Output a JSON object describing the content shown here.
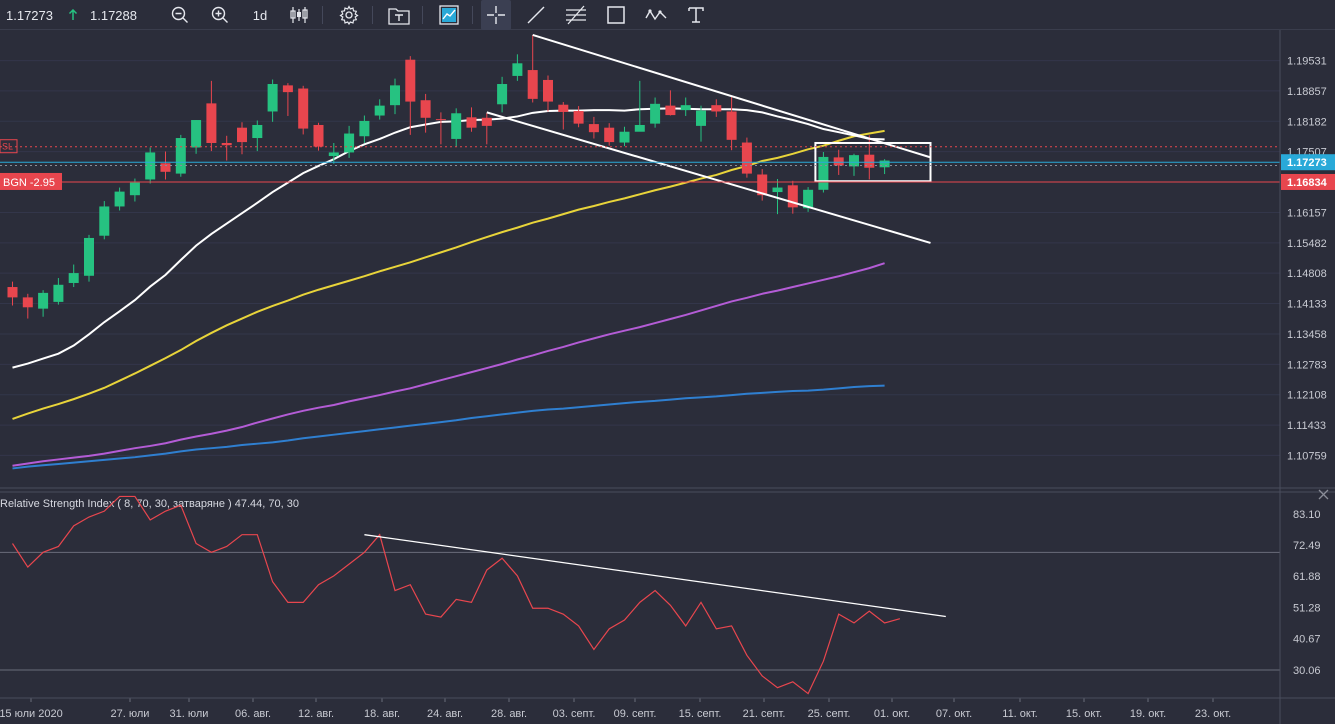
{
  "toolbar": {
    "bid": "1.17273",
    "ask": "1.17288",
    "direction_icon": "arrow-up-icon",
    "timeframe": "1d",
    "colors": {
      "up": "#26c281",
      "text": "#e6e8ee"
    }
  },
  "chart_data": [
    {
      "type": "candlestick",
      "y_ticks": [
        "1.19531",
        "1.18857",
        "1.18182",
        "1.17507",
        "1.16157",
        "1.15482",
        "1.14808",
        "1.14133",
        "1.13458",
        "1.12783",
        "1.12108",
        "1.11433",
        "1.10759"
      ],
      "y_tick_values": [
        1.19531,
        1.18857,
        1.18182,
        1.17507,
        1.16157,
        1.15482,
        1.14808,
        1.14133,
        1.13458,
        1.12783,
        1.12108,
        1.11433,
        1.10759
      ],
      "ylim": [
        1.1008,
        1.2021
      ],
      "x_tick_labels": [
        "15 юли 2020",
        "27. юли",
        "31. юли",
        "06. авг.",
        "12. авг.",
        "18. авг.",
        "24. авг.",
        "28. авг.",
        "03. септ.",
        "09. септ.",
        "15. септ.",
        "21. септ.",
        "25. септ.",
        "01. окт.",
        "07. окт.",
        "11. окт.",
        "15. окт.",
        "19. окт.",
        "23. окт."
      ],
      "price_badges": [
        {
          "label": "1.17273",
          "value": 1.17273,
          "color": "#29a9d8"
        },
        {
          "label": "1.16834",
          "value": 1.16834,
          "color": "#e8464e"
        }
      ],
      "order_lines": [
        {
          "label": "BGN -2.95",
          "value": 1.16834,
          "color": "#e8464e"
        },
        {
          "label": "SL",
          "value": 1.17617,
          "color": "#e8464e"
        }
      ],
      "current_price": 1.17273,
      "colors": {
        "up": "#26c281",
        "down": "#e8464e",
        "ma20": "#ffffff",
        "ma50": "#e8d43a",
        "ma100": "#b45cd6",
        "ma200": "#2f7fd0",
        "trendline": "#ffffff",
        "bid_line": "#29a9d8"
      },
      "candles": [
        [
          1.145,
          1.1427,
          1.1462,
          1.1409
        ],
        [
          1.1427,
          1.1405,
          1.1435,
          1.138
        ],
        [
          1.1402,
          1.1437,
          1.1443,
          1.1384
        ],
        [
          1.1417,
          1.1455,
          1.147,
          1.1411
        ],
        [
          1.1459,
          1.1481,
          1.15,
          1.145
        ],
        [
          1.1475,
          1.1559,
          1.1566,
          1.1462
        ],
        [
          1.1564,
          1.1629,
          1.1641,
          1.1556
        ],
        [
          1.1629,
          1.1662,
          1.1671,
          1.162
        ],
        [
          1.1654,
          1.1682,
          1.1691,
          1.164
        ],
        [
          1.1689,
          1.1749,
          1.176,
          1.168
        ],
        [
          1.1725,
          1.1706,
          1.1751,
          1.1689
        ],
        [
          1.1702,
          1.1781,
          1.1788,
          1.1695
        ],
        [
          1.176,
          1.1821,
          1.1821,
          1.1746
        ],
        [
          1.1858,
          1.177,
          1.1908,
          1.1752
        ],
        [
          1.177,
          1.1765,
          1.1786,
          1.1731
        ],
        [
          1.1804,
          1.1772,
          1.1816,
          1.1745
        ],
        [
          1.1781,
          1.181,
          1.182,
          1.1752
        ],
        [
          1.184,
          1.1901,
          1.1911,
          1.1817
        ],
        [
          1.1898,
          1.1883,
          1.1903,
          1.183
        ],
        [
          1.1891,
          1.1802,
          1.1897,
          1.1789
        ],
        [
          1.181,
          1.1762,
          1.1815,
          1.1753
        ],
        [
          1.1741,
          1.1749,
          1.177,
          1.1724
        ],
        [
          1.1749,
          1.1791,
          1.1808,
          1.1737
        ],
        [
          1.1785,
          1.1819,
          1.1831,
          1.177
        ],
        [
          1.1831,
          1.1853,
          1.1867,
          1.1822
        ],
        [
          1.1854,
          1.1898,
          1.1913,
          1.1834
        ],
        [
          1.1955,
          1.1862,
          1.1963,
          1.1788
        ],
        [
          1.1865,
          1.1826,
          1.1879,
          1.1793
        ],
        [
          1.1823,
          1.1821,
          1.1838,
          1.1767
        ],
        [
          1.1779,
          1.1836,
          1.1847,
          1.1762
        ],
        [
          1.1827,
          1.1804,
          1.1849,
          1.1795
        ],
        [
          1.1826,
          1.1808,
          1.1837,
          1.1767
        ],
        [
          1.1856,
          1.1901,
          1.1917,
          1.1838
        ],
        [
          1.1919,
          1.1947,
          1.1967,
          1.1908
        ],
        [
          1.1932,
          1.1868,
          1.201,
          1.186
        ],
        [
          1.191,
          1.1862,
          1.192,
          1.184
        ],
        [
          1.1855,
          1.1839,
          1.1861,
          1.18
        ],
        [
          1.1841,
          1.1813,
          1.1852,
          1.1805
        ],
        [
          1.1812,
          1.1794,
          1.1828,
          1.178
        ],
        [
          1.1804,
          1.1772,
          1.1814,
          1.1764
        ],
        [
          1.1771,
          1.1795,
          1.1806,
          1.1763
        ],
        [
          1.1795,
          1.181,
          1.1908,
          1.1802
        ],
        [
          1.1813,
          1.1857,
          1.1871,
          1.1804
        ],
        [
          1.1853,
          1.1832,
          1.1887,
          1.1831
        ],
        [
          1.1843,
          1.1854,
          1.1871,
          1.183
        ],
        [
          1.1808,
          1.1842,
          1.1853,
          1.1773
        ],
        [
          1.1854,
          1.184,
          1.1867,
          1.1828
        ],
        [
          1.184,
          1.1777,
          1.1872,
          1.1754
        ],
        [
          1.1771,
          1.1702,
          1.1782,
          1.1693
        ],
        [
          1.17,
          1.1654,
          1.1712,
          1.1642
        ],
        [
          1.1661,
          1.1671,
          1.169,
          1.1612
        ],
        [
          1.1676,
          1.1627,
          1.1686,
          1.1613
        ],
        [
          1.1625,
          1.1666,
          1.1672,
          1.1617
        ],
        [
          1.1666,
          1.1739,
          1.175,
          1.166
        ],
        [
          1.1738,
          1.172,
          1.1755,
          1.1699
        ],
        [
          1.1718,
          1.1743,
          1.1746,
          1.1697
        ],
        [
          1.1744,
          1.1715,
          1.1787,
          1.1689
        ],
        [
          1.1716,
          1.1731,
          1.1734,
          1.1701
        ]
      ],
      "ma20": [
        1.1271,
        1.128,
        1.1291,
        1.1302,
        1.132,
        1.1345,
        1.1372,
        1.1396,
        1.1421,
        1.1451,
        1.1477,
        1.151,
        1.1542,
        1.1568,
        1.1591,
        1.1614,
        1.1637,
        1.1661,
        1.1682,
        1.1703,
        1.1719,
        1.1734,
        1.1752,
        1.1767,
        1.1779,
        1.1793,
        1.1805,
        1.1811,
        1.1817,
        1.1818,
        1.1821,
        1.1822,
        1.1824,
        1.1829,
        1.1837,
        1.1841,
        1.1842,
        1.1842,
        1.1843,
        1.1843,
        1.1842,
        1.1845,
        1.1846,
        1.1847,
        1.1846,
        1.1845,
        1.1845,
        1.1845,
        1.1843,
        1.1838,
        1.1829,
        1.1821,
        1.1812,
        1.1801,
        1.1794,
        1.1787,
        1.1779,
        1.1778
      ],
      "ma50": [
        1.1157,
        1.1169,
        1.118,
        1.119,
        1.1201,
        1.1213,
        1.1226,
        1.1242,
        1.1258,
        1.1275,
        1.1292,
        1.131,
        1.133,
        1.1348,
        1.1365,
        1.138,
        1.1395,
        1.1408,
        1.142,
        1.1433,
        1.1444,
        1.1454,
        1.1464,
        1.1474,
        1.1485,
        1.1495,
        1.1505,
        1.1516,
        1.1527,
        1.1538,
        1.155,
        1.1561,
        1.1572,
        1.1582,
        1.1593,
        1.1602,
        1.1612,
        1.1622,
        1.163,
        1.1639,
        1.1647,
        1.1656,
        1.1665,
        1.1673,
        1.1682,
        1.1691,
        1.1699,
        1.171,
        1.1719,
        1.173,
        1.1737,
        1.1746,
        1.1756,
        1.1764,
        1.1775,
        1.1785,
        1.1791,
        1.1797
      ],
      "ma100": [
        1.1053,
        1.1058,
        1.1063,
        1.1067,
        1.1071,
        1.1075,
        1.108,
        1.1086,
        1.1092,
        1.1097,
        1.1103,
        1.1111,
        1.1118,
        1.1124,
        1.1131,
        1.1139,
        1.1149,
        1.1158,
        1.1167,
        1.1175,
        1.1182,
        1.1188,
        1.1196,
        1.1203,
        1.121,
        1.1218,
        1.1225,
        1.1234,
        1.1243,
        1.1252,
        1.1261,
        1.127,
        1.1279,
        1.1289,
        1.1298,
        1.1308,
        1.1317,
        1.1327,
        1.1336,
        1.1345,
        1.1353,
        1.1361,
        1.137,
        1.1379,
        1.1388,
        1.1398,
        1.1408,
        1.1418,
        1.1426,
        1.1435,
        1.1442,
        1.145,
        1.1458,
        1.1466,
        1.1474,
        1.1483,
        1.1492,
        1.1503
      ],
      "ma200": [
        1.1047,
        1.1051,
        1.1054,
        1.1057,
        1.106,
        1.1063,
        1.1066,
        1.1069,
        1.1072,
        1.1076,
        1.108,
        1.1085,
        1.1089,
        1.1092,
        1.1095,
        1.1099,
        1.1102,
        1.1105,
        1.1109,
        1.1114,
        1.1118,
        1.1122,
        1.1126,
        1.113,
        1.1134,
        1.1138,
        1.1142,
        1.1146,
        1.115,
        1.1154,
        1.1159,
        1.1163,
        1.1167,
        1.1171,
        1.1175,
        1.1178,
        1.118,
        1.1183,
        1.1186,
        1.1189,
        1.1192,
        1.1195,
        1.1197,
        1.12,
        1.1203,
        1.1205,
        1.1207,
        1.121,
        1.1213,
        1.1215,
        1.1217,
        1.1219,
        1.122,
        1.1222,
        1.1225,
        1.1228,
        1.123,
        1.1231
      ],
      "trendlines": [
        {
          "from": [
            34,
            1.201
          ],
          "to": [
            60,
            1.1738
          ]
        },
        {
          "from": [
            31,
            1.1838
          ],
          "to": [
            60,
            1.1548
          ]
        }
      ],
      "highlight_box": {
        "from_index": 53,
        "to_index": 60,
        "high": 1.177,
        "low": 1.1685
      }
    },
    {
      "type": "line",
      "title": "Relative Strength Index ( 8, 70, 30, затваряне ) 47.44, 70, 30",
      "y_ticks": [
        "83.10",
        "72.49",
        "61.88",
        "51.28",
        "40.67",
        "30.06"
      ],
      "y_tick_values": [
        83.1,
        72.49,
        61.88,
        51.28,
        40.67,
        30.06
      ],
      "ylim": [
        20.5,
        90.5
      ],
      "levels": [
        70,
        30
      ],
      "series": [
        {
          "values": [
            73,
            65,
            70,
            72,
            79,
            82,
            84,
            89,
            89,
            81,
            84,
            86,
            73,
            70,
            72,
            76,
            76,
            60,
            53,
            53,
            59,
            62,
            66,
            70,
            76,
            57,
            59,
            49,
            48,
            54,
            53,
            64,
            68,
            62,
            51,
            51,
            49,
            45,
            37,
            44,
            47,
            53,
            57,
            52,
            45,
            53,
            44,
            45,
            35,
            28,
            24,
            26,
            22,
            33,
            49,
            46,
            50,
            46,
            47.44
          ]
        }
      ],
      "trendline": {
        "from": [
          23,
          76
        ],
        "to": [
          61,
          48.2
        ]
      },
      "colors": {
        "rsi": "#e8464e",
        "trendline": "#ffffff",
        "level": "#6a6d7a"
      }
    }
  ]
}
